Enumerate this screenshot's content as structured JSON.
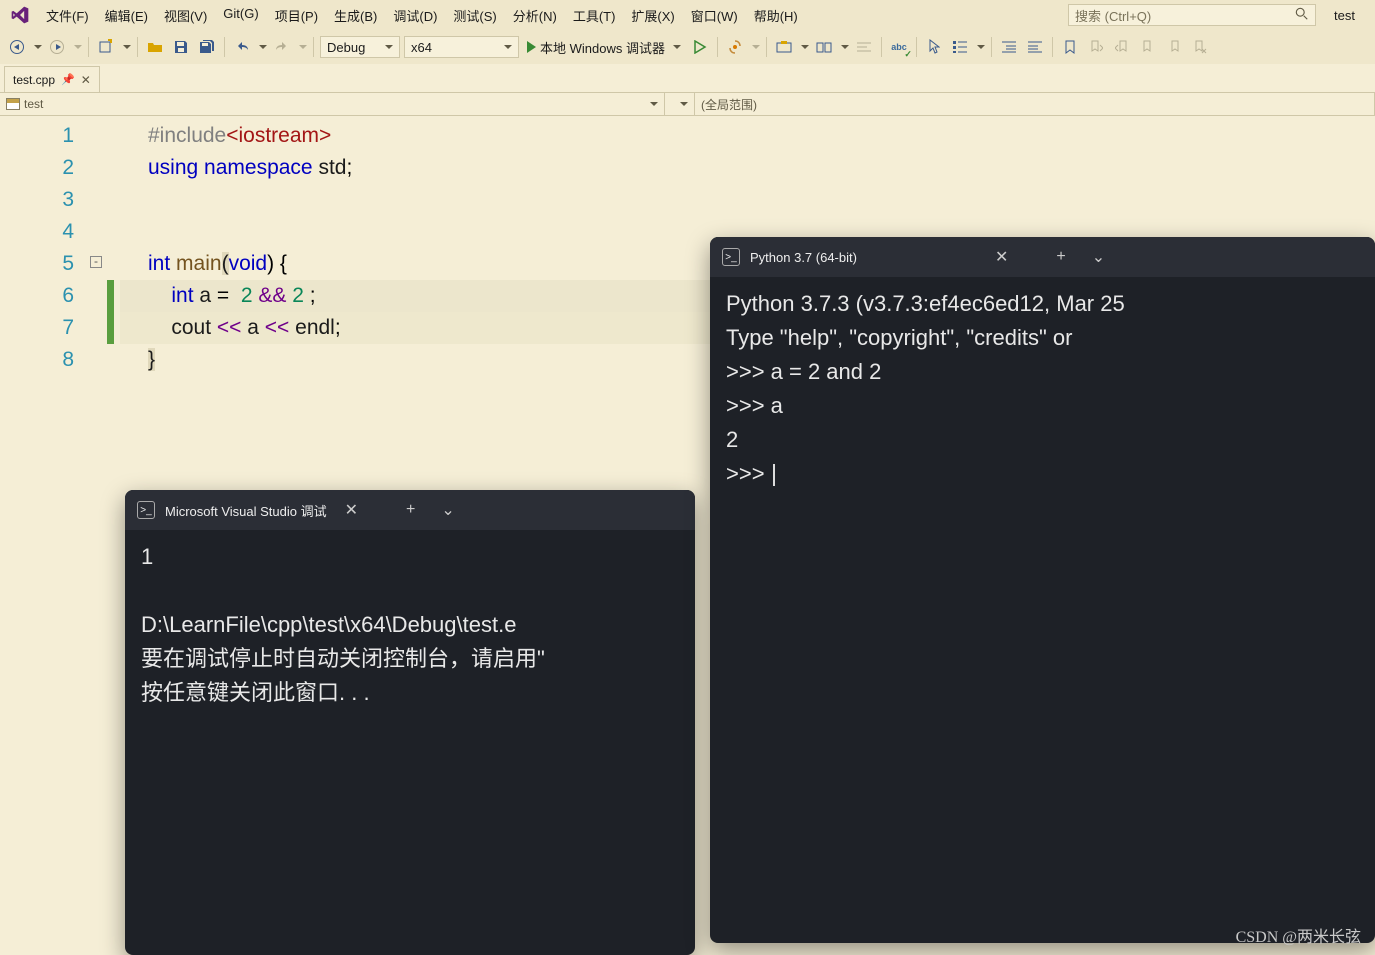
{
  "menubar": {
    "items": [
      "文件(F)",
      "编辑(E)",
      "视图(V)",
      "Git(G)",
      "项目(P)",
      "生成(B)",
      "调试(D)",
      "测试(S)",
      "分析(N)",
      "工具(T)",
      "扩展(X)",
      "窗口(W)",
      "帮助(H)"
    ],
    "search_placeholder": "搜索 (Ctrl+Q)",
    "solution": "test"
  },
  "toolbar": {
    "config": "Debug",
    "platform": "x64",
    "debug_label": "本地 Windows 调试器"
  },
  "tab": {
    "title": "test.cpp"
  },
  "navbar": {
    "left": "test",
    "right": "(全局范围)"
  },
  "code": {
    "line1": {
      "pp": "#include",
      "str": "<iostream>"
    },
    "line2": {
      "kw1": "using",
      "kw2": "namespace",
      "id": "std",
      "semi": ";"
    },
    "line5": {
      "kw": "int",
      "fn": "main",
      "lp": "(",
      "arg": "void",
      "rp": ")",
      "brace": " {"
    },
    "line6": {
      "kw": "int",
      "id": " a ",
      "eq": "=",
      "n1": "2",
      "op": "&&",
      "n2": "2",
      "semi": ";"
    },
    "line7": {
      "id": "cout",
      "op1": " << ",
      "a": "a",
      "op2": " << ",
      "endl": "endl",
      "semi": ";"
    },
    "line8": {
      "brace": "}"
    },
    "numbers": [
      "1",
      "2",
      "3",
      "4",
      "5",
      "6",
      "7",
      "8"
    ]
  },
  "debug_console": {
    "title": "Microsoft Visual Studio 调试",
    "lines": [
      "1",
      "",
      "D:\\LearnFile\\cpp\\test\\x64\\Debug\\test.e",
      "要在调试停止时自动关闭控制台，请启用\"",
      "按任意键关闭此窗口. . ."
    ]
  },
  "python_console": {
    "title": "Python 3.7 (64-bit)",
    "lines": [
      "Python 3.7.3 (v3.7.3:ef4ec6ed12, Mar 25",
      "Type \"help\", \"copyright\", \"credits\" or ",
      ">>> a = 2 and 2",
      ">>> a",
      "2",
      ">>> "
    ]
  },
  "watermark": "CSDN @两米长弦"
}
